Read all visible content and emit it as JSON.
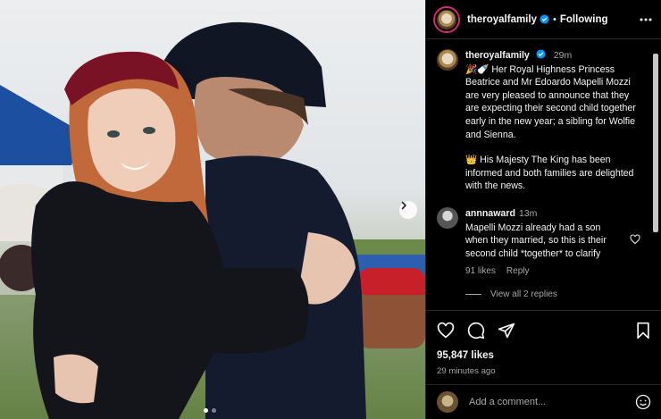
{
  "post": {
    "image_alt": "Couple embracing outdoors",
    "carousel_total": 2,
    "carousel_index": 1
  },
  "header": {
    "username": "theroyalfamily",
    "verified": true,
    "separator": "•",
    "follow_state": "Following"
  },
  "comments": [
    {
      "username": "theroyalfamily",
      "verified": true,
      "time": "29m",
      "paragraphs": [
        "🎉🍼 Her Royal Highness Princess Beatrice and Mr Edoardo Mapelli Mozzi are very pleased to announce that they are expecting their second child together early in the new year; a sibling for Wolfie and Sienna.",
        "👑 His Majesty The King has been informed and both families are delighted with the news."
      ]
    },
    {
      "username": "annnaward",
      "time": "13m",
      "text": "Mapelli Mozzi already had a son when they married, so this is their second child *together* to clarify",
      "likes": "91 likes",
      "reply_label": "Reply",
      "view_replies": "View all 2 replies"
    }
  ],
  "actions": {
    "likes": "95,847 likes",
    "time_ago": "29 minutes ago"
  },
  "composer": {
    "placeholder": "Add a comment..."
  },
  "colors": {
    "background": "#000000",
    "text": "#f5f5f5",
    "secondary_text": "#a8a8a8",
    "verified_blue": "#0095f6",
    "story_ring": "#d62976"
  }
}
